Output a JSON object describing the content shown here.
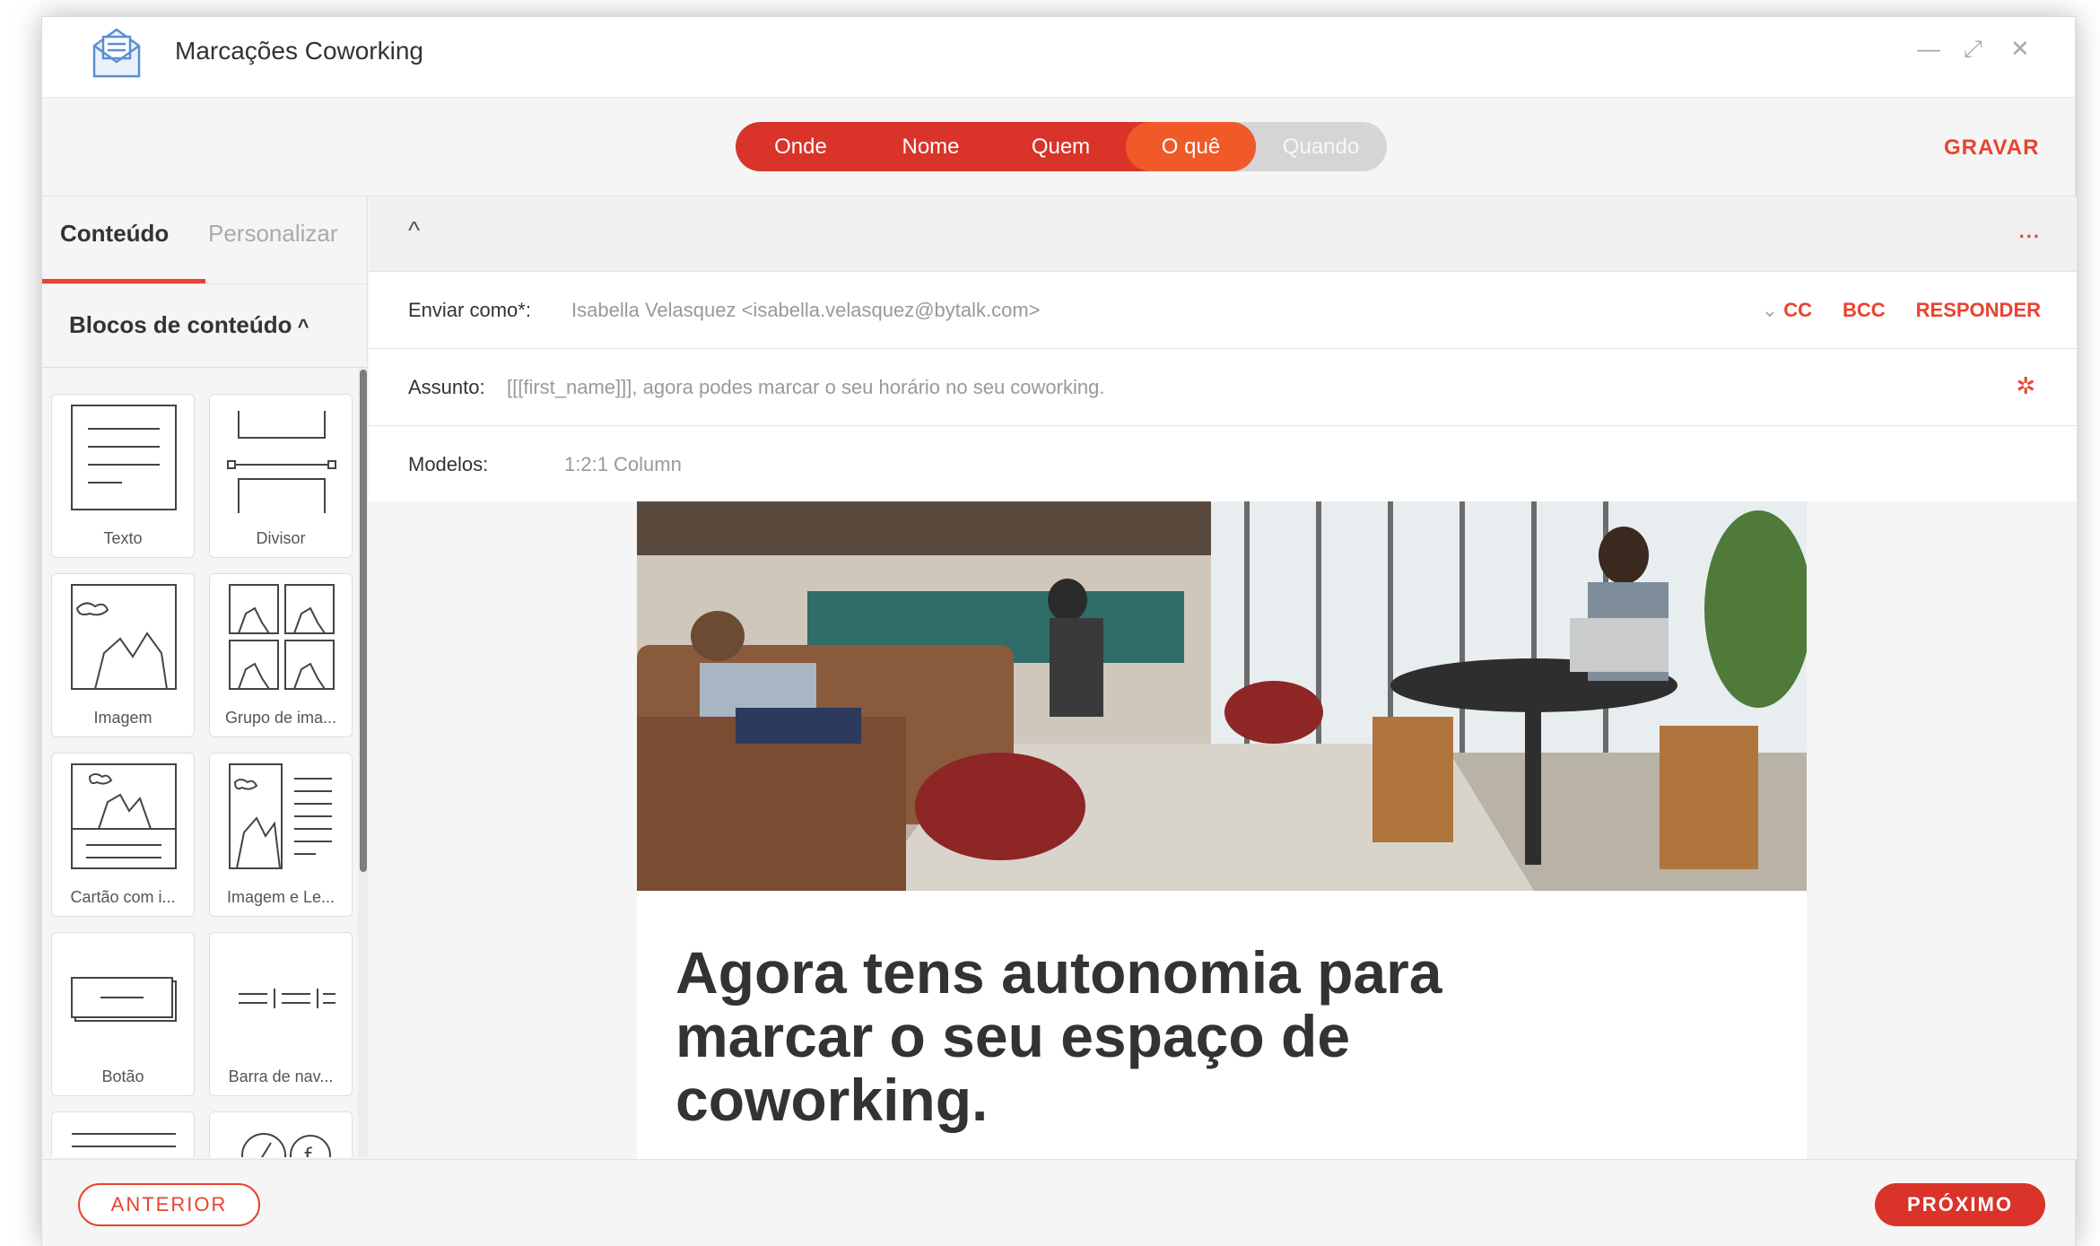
{
  "window": {
    "title": "Marcações Coworking",
    "controls": {
      "minimize": "—",
      "maximize": "⤢",
      "close": "✕"
    }
  },
  "steps": [
    {
      "label": "Onde",
      "state": "done"
    },
    {
      "label": "Nome",
      "state": "done"
    },
    {
      "label": "Quem",
      "state": "done"
    },
    {
      "label": "O quê",
      "state": "active"
    },
    {
      "label": "Quando",
      "state": "pending"
    }
  ],
  "toolbar": {
    "save_label": "GRAVAR"
  },
  "sidebar": {
    "tabs": [
      "Conteúdo",
      "Personalizar"
    ],
    "blocks_header": "Blocos de conteúdo",
    "blocks_header_icon": "chevron-up-icon",
    "blocks": [
      {
        "label": "Texto",
        "icon": "text-block-icon"
      },
      {
        "label": "Divisor",
        "icon": "divider-block-icon"
      },
      {
        "label": "Imagem",
        "icon": "image-block-icon"
      },
      {
        "label": "Grupo de ima...",
        "icon": "image-group-block-icon"
      },
      {
        "label": "Cartão com i...",
        "icon": "image-card-block-icon"
      },
      {
        "label": "Imagem e Le...",
        "icon": "image-text-block-icon"
      },
      {
        "label": "Botão",
        "icon": "button-block-icon"
      },
      {
        "label": "Barra de nav...",
        "icon": "navbar-block-icon"
      },
      {
        "label": "",
        "icon": "text-lines-block-icon"
      },
      {
        "label": "",
        "icon": "social-block-icon"
      }
    ]
  },
  "editor": {
    "collapse_icon": "chevron-up-icon",
    "more_label": "...",
    "send_as": {
      "label": "Enviar como*:",
      "value": "Isabella Velasquez <isabella.velasquez@bytalk.com>",
      "cc": "CC",
      "bcc": "BCC",
      "reply": "RESPONDER"
    },
    "subject": {
      "label": "Assunto:",
      "value": "[[[first_name]]], agora podes marcar o seu horário no seu coworking."
    },
    "templates": {
      "label": "Modelos:",
      "value": "1:2:1 Column"
    }
  },
  "email": {
    "headline": "Agora tens autonomia para marcar o seu espaço de coworking."
  },
  "footer": {
    "prev_label": "ANTERIOR",
    "next_label": "PRÓXIMO"
  },
  "colors": {
    "accent": "#e8432f",
    "step_done": "#d9332a",
    "step_active": "#f05a28",
    "step_pending": "#d5d5d5"
  }
}
